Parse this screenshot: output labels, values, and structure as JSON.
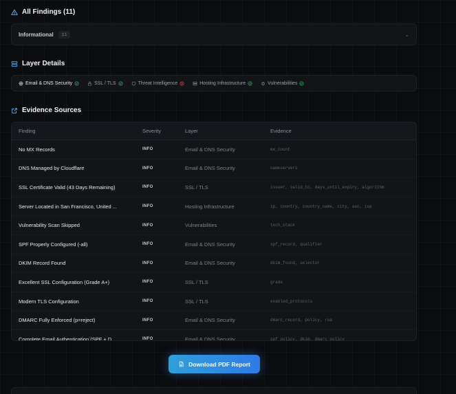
{
  "findings": {
    "title": "All Findings (11)",
    "group_label": "Informational",
    "group_count": "11"
  },
  "layers": {
    "title": "Layer Details",
    "items": [
      {
        "label": "Email & DNS Security",
        "icon": "globe-icon",
        "status": "pass",
        "status_color": "#22c55e"
      },
      {
        "label": "SSL / TLS",
        "icon": "lock-icon",
        "status": "pass",
        "status_color": "#22c55e"
      },
      {
        "label": "Threat Intelligence",
        "icon": "shield-icon",
        "status": "fail",
        "status_color": "#ef4444"
      },
      {
        "label": "Hosting Infrastructure",
        "icon": "server-icon",
        "status": "pass",
        "status_color": "#22c55e"
      },
      {
        "label": "Vulnerabilities",
        "icon": "bug-icon",
        "status": "pass",
        "status_color": "#22c55e"
      }
    ]
  },
  "evidence": {
    "title": "Evidence Sources",
    "columns": [
      "Finding",
      "Severity",
      "Layer",
      "Evidence"
    ],
    "rows": [
      {
        "finding": "No MX Records",
        "severity": "INFO",
        "layer": "Email & DNS Security",
        "evidence": "mx_count"
      },
      {
        "finding": "DNS Managed by Cloudflare",
        "severity": "INFO",
        "layer": "Email & DNS Security",
        "evidence": "nameservers"
      },
      {
        "finding": "SSL Certificate Valid (43 Days Remaining)",
        "severity": "INFO",
        "layer": "SSL / TLS",
        "evidence": "issuer, valid_to, days_until_expiry, algorithm"
      },
      {
        "finding": "Server Located in San Francisco, United ...",
        "severity": "INFO",
        "layer": "Hosting Infrastructure",
        "evidence": "ip, country, country_name, city, asn, isp"
      },
      {
        "finding": "Vulnerability Scan Skipped",
        "severity": "INFO",
        "layer": "Vulnerabilities",
        "evidence": "tech_stack"
      },
      {
        "finding": "SPF Properly Configured (-all)",
        "severity": "INFO",
        "layer": "Email & DNS Security",
        "evidence": "spf_record, qualifier"
      },
      {
        "finding": "DKIM Record Found",
        "severity": "INFO",
        "layer": "Email & DNS Security",
        "evidence": "dkim_found, selector"
      },
      {
        "finding": "Excellent SSL Configuration (Grade A+)",
        "severity": "INFO",
        "layer": "SSL / TLS",
        "evidence": "grade"
      },
      {
        "finding": "Modern TLS Configuration",
        "severity": "INFO",
        "layer": "SSL / TLS",
        "evidence": "enabled_protocols"
      },
      {
        "finding": "DMARC Fully Enforced (p=reject)",
        "severity": "INFO",
        "layer": "Email & DNS Security",
        "evidence": "dmarc_record, policy, rua"
      },
      {
        "finding": "Complete Email Authentication (SPF + D...",
        "severity": "INFO",
        "layer": "Email & DNS Security",
        "evidence": "spf_policy, dkim, dmarc_policy"
      }
    ]
  },
  "download": {
    "label": "Download PDF Report"
  }
}
